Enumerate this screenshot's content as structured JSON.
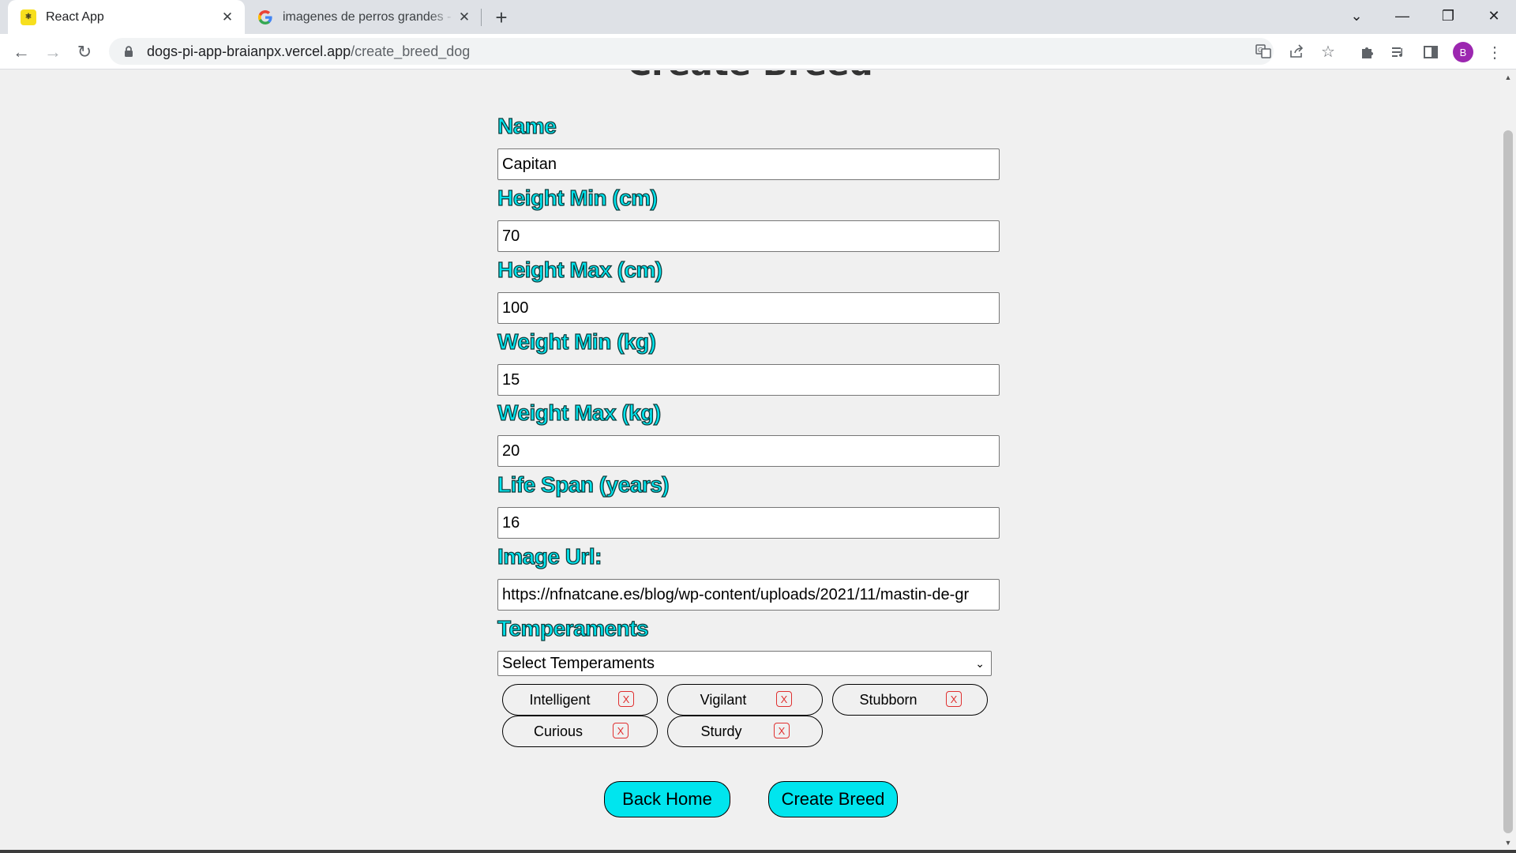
{
  "browser": {
    "tabs": [
      {
        "title": "React App",
        "favicon": "react-favicon",
        "active": true
      },
      {
        "title": "imagenes de perros grandes - Buscar con Google",
        "favicon": "google-g-icon",
        "active": false
      }
    ],
    "url_host": "dogs-pi-app-braianpx.vercel.app",
    "url_path": "/create_breed_dog",
    "profile_initial": "B"
  },
  "page": {
    "heading": "Create Breed",
    "form": {
      "name": {
        "label": "Name",
        "value": "Capitan"
      },
      "height_min": {
        "label": "Height Min (cm)",
        "value": "70"
      },
      "height_max": {
        "label": "Height Max (cm)",
        "value": "100"
      },
      "weight_min": {
        "label": "Weight Min (kg)",
        "value": "15"
      },
      "weight_max": {
        "label": "Weight Max (kg)",
        "value": "20"
      },
      "life_span": {
        "label": "Life Span (years)",
        "value": "16"
      },
      "image_url": {
        "label": "Image Url:",
        "value": "https://nfnatcane.es/blog/wp-content/uploads/2021/11/mastin-de-gr"
      },
      "temperaments": {
        "label": "Temperaments",
        "select_value": "Select Temperaments"
      }
    },
    "chips": [
      {
        "label": "Intelligent",
        "remove": "X"
      },
      {
        "label": "Vigilant",
        "remove": "X"
      },
      {
        "label": "Stubborn",
        "remove": "X"
      },
      {
        "label": "Curious",
        "remove": "X"
      },
      {
        "label": "Sturdy",
        "remove": "X"
      }
    ],
    "buttons": {
      "back": "Back Home",
      "create": "Create Breed"
    }
  },
  "colors": {
    "label_fill": "#00e5ee",
    "button_fill": "#00e5ee",
    "chip_remove": "#e03030"
  }
}
